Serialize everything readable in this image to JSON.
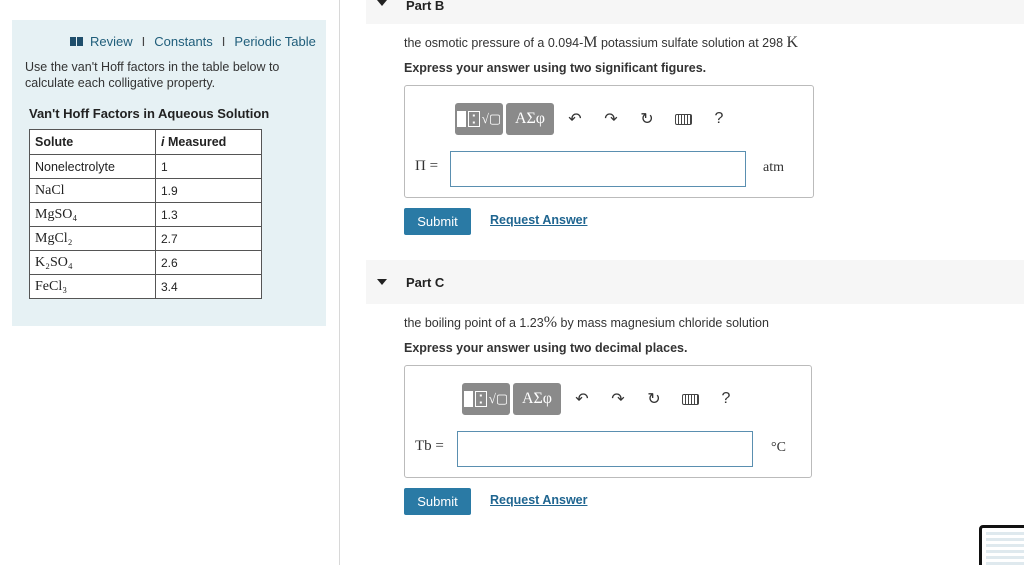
{
  "left_panel": {
    "links": [
      "Review",
      "Constants",
      "Periodic Table"
    ],
    "intro": "Use the van't Hoff factors in the table below to calculate each colligative property.",
    "table_title": "Van't Hoff Factors in Aqueous Solution",
    "headers": {
      "solute": "Solute",
      "measured_i": "i",
      "measured_rest": " Measured"
    },
    "rows": [
      {
        "solute": "Nonelectrolyte",
        "value": "1"
      },
      {
        "solute": "NaCl",
        "value": "1.9"
      },
      {
        "solute": "MgSO₄",
        "value": "1.3"
      },
      {
        "solute": "MgCl₂",
        "value": "2.7"
      },
      {
        "solute": "K₂SO₄",
        "value": "2.6"
      },
      {
        "solute": "FeCl₃",
        "value": "3.4"
      }
    ]
  },
  "part_b": {
    "label": "Part B",
    "question_pre": "the osmotic pressure of a 0.094-",
    "question_unit1": "M",
    "question_mid": " potassium sulfate solution at 298 ",
    "question_unit2": "K",
    "instruction": "Express your answer using two significant figures.",
    "variable": "Π =",
    "unit": "atm",
    "input_value": "",
    "submit": "Submit",
    "request": "Request Answer"
  },
  "part_c": {
    "label": "Part C",
    "question_pre": "the boiling point of a 1.23",
    "question_unit1": "%",
    "question_post": " by mass magnesium chloride solution",
    "instruction": "Express your answer using two decimal places.",
    "variable": "Tb =",
    "unit": "°C",
    "input_value": "",
    "submit": "Submit",
    "request": "Request Answer"
  },
  "toolbar": {
    "greek": "ΑΣφ",
    "help": "?",
    "icons": [
      "templates-icon",
      "greek-letters-icon",
      "undo-icon",
      "redo-icon",
      "reset-icon",
      "keyboard-icon",
      "help-icon"
    ]
  }
}
